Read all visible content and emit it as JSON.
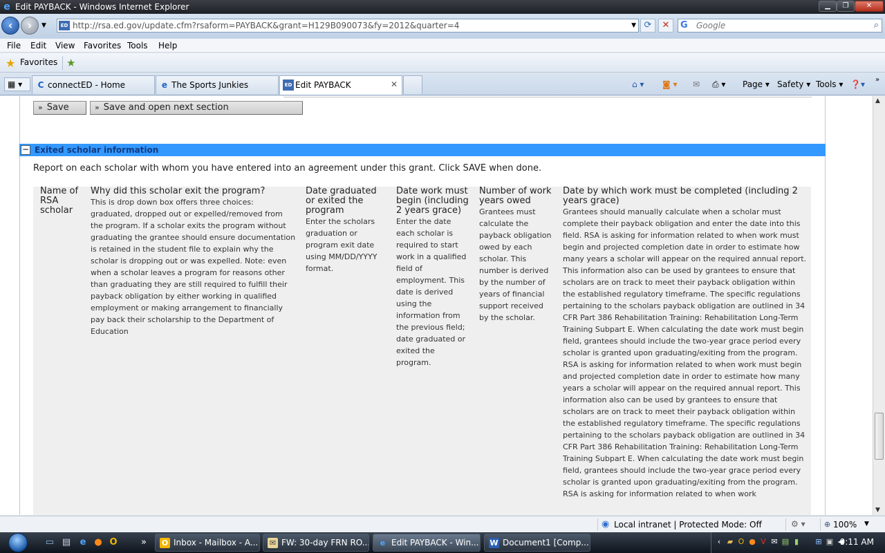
{
  "window": {
    "title": "Edit PAYBACK - Windows Internet Explorer"
  },
  "address_bar": {
    "url": "http://rsa.ed.gov/update.cfm?rsaform=PAYBACK&grant=H129B090073&fy=2012&quarter=4",
    "search_placeholder": "Google"
  },
  "menu": [
    "File",
    "Edit",
    "View",
    "Favorites",
    "Tools",
    "Help"
  ],
  "favorites_bar": {
    "label": "Favorites"
  },
  "tabs": [
    {
      "label": "connectED - Home",
      "icon": "connected-favicon",
      "active": false
    },
    {
      "label": "The Sports Junkies",
      "icon": "ie-page-icon",
      "active": false
    },
    {
      "label": "Edit PAYBACK",
      "icon": "ed-favicon",
      "active": true
    }
  ],
  "command_bar": {
    "page": "Page",
    "safety": "Safety",
    "tools": "Tools"
  },
  "page": {
    "buttons": {
      "save": "Save",
      "save_open_next": "Save and open next section"
    },
    "section_title": "Exited scholar information",
    "intro": "Report on each scholar with whom you have entered into an agreement under this grant. Click SAVE when done.",
    "columns": [
      {
        "header": "Name of RSA scholar",
        "desc": ""
      },
      {
        "header": "Why did this scholar exit the program?",
        "desc": "This is drop down box offers three choices: graduated, dropped out or expelled/removed from the program. If a scholar exits the program without graduating the grantee should ensure documentation is retained in the student file to explain why the scholar is dropping out or was expelled. Note: even when a scholar leaves a program for reasons other than graduating they are still required to fulfill their payback obligation by either working in qualified employment or making arrangement to financially pay back their scholarship to the Department of Education"
      },
      {
        "header": "Date graduated or exited the program",
        "desc": "Enter the scholars graduation or program exit date using MM/DD/YYYY format."
      },
      {
        "header": "Date work must begin (including 2 years grace)",
        "desc": "Enter the date each scholar is required to start work in a qualified field of employment. This date is derived using the information from the previous field; date graduated or exited the program."
      },
      {
        "header": "Number of work years owed",
        "desc": "Grantees must calculate the payback obligation owed by each scholar. This number is derived by the number of years of financial support received by the scholar."
      },
      {
        "header": "Date by which work must be completed (including 2 years grace)",
        "desc": "Grantees should manually calculate when a scholar must complete their payback obligation and enter the date into this field. RSA is asking for information related to when work must begin and projected completion date in order to estimate how many years a scholar will appear on the required annual report. This information also can be used by grantees to ensure that scholars are on track to meet their payback obligation within the established regulatory timeframe. The specific regulations pertaining to the scholars payback obligation are outlined in 34 CFR Part 386 Rehabilitation Training: Rehabilitation Long-Term Training Subpart E. When calculating the date work must begin field, grantees should include the two-year grace period every scholar is granted upon graduating/exiting from the program. RSA is asking for information related to when work must begin and projected completion date in order to estimate how many years a scholar will appear on the required annual report. This information also can be used by grantees to ensure that scholars are on track to meet their payback obligation within the established regulatory timeframe. The specific regulations pertaining to the scholars payback obligation are outlined in 34 CFR Part 386 Rehabilitation Training: Rehabilitation Long-Term Training Subpart E. When calculating the date work must begin field, grantees should include the two-year grace period every scholar is granted upon graduating/exiting from the program. RSA is asking for information related to when work"
      }
    ]
  },
  "status_bar": {
    "zone": "Local intranet | Protected Mode: Off",
    "zoom": "100%"
  },
  "taskbar": {
    "tasks": [
      {
        "label": "Inbox - Mailbox - A...",
        "icon": "outlook-icon",
        "active": false
      },
      {
        "label": "FW: 30-day FRN RO...",
        "icon": "mail-icon",
        "active": false
      },
      {
        "label": "Edit PAYBACK - Win...",
        "icon": "ie-icon",
        "active": true
      },
      {
        "label": "Document1 [Comp...",
        "icon": "word-icon",
        "active": false
      }
    ],
    "clock": "9:11 AM"
  }
}
